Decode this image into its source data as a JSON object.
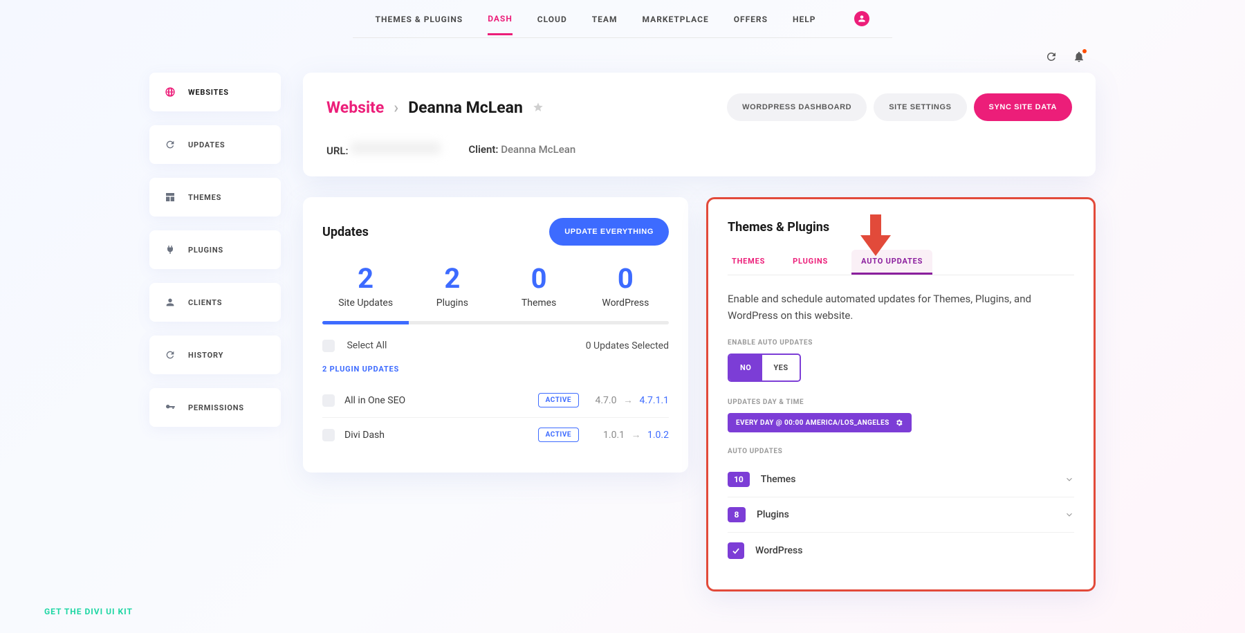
{
  "topNav": {
    "items": [
      "THEMES & PLUGINS",
      "DASH",
      "CLOUD",
      "TEAM",
      "MARKETPLACE",
      "OFFERS",
      "HELP"
    ],
    "activeIndex": 1
  },
  "sidebar": {
    "items": [
      {
        "label": "WEBSITES",
        "icon": "globe"
      },
      {
        "label": "UPDATES",
        "icon": "refresh"
      },
      {
        "label": "THEMES",
        "icon": "layout"
      },
      {
        "label": "PLUGINS",
        "icon": "plug"
      },
      {
        "label": "CLIENTS",
        "icon": "user"
      },
      {
        "label": "HISTORY",
        "icon": "refresh"
      },
      {
        "label": "PERMISSIONS",
        "icon": "key"
      }
    ],
    "activeIndex": 0
  },
  "header": {
    "breadcrumbRoot": "Website",
    "breadcrumbLeaf": "Deanna McLean",
    "urlLabel": "URL:",
    "clientLabel": "Client:",
    "clientName": "Deanna McLean",
    "actions": {
      "wpDash": "WORDPRESS DASHBOARD",
      "siteSettings": "SITE SETTINGS",
      "syncSite": "SYNC SITE DATA"
    }
  },
  "updates": {
    "title": "Updates",
    "updateAllBtn": "UPDATE EVERYTHING",
    "stats": [
      {
        "num": "2",
        "label": "Site Updates"
      },
      {
        "num": "2",
        "label": "Plugins"
      },
      {
        "num": "0",
        "label": "Themes"
      },
      {
        "num": "0",
        "label": "WordPress"
      }
    ],
    "selectAll": "Select All",
    "selectedText": "0 Updates Selected",
    "pluginSectionLabel": "2 PLUGIN UPDATES",
    "plugins": [
      {
        "name": "All in One SEO",
        "status": "ACTIVE",
        "from": "4.7.0",
        "to": "4.7.1.1"
      },
      {
        "name": "Divi Dash",
        "status": "ACTIVE",
        "from": "1.0.1",
        "to": "1.0.2"
      }
    ]
  },
  "autoUpdates": {
    "title": "Themes & Plugins",
    "tabs": [
      "THEMES",
      "PLUGINS",
      "AUTO UPDATES"
    ],
    "activeTab": 2,
    "description": "Enable and schedule automated updates for Themes, Plugins, and WordPress on this website.",
    "enableLabel": "ENABLE AUTO UPDATES",
    "toggleNo": "NO",
    "toggleYes": "YES",
    "scheduleLabel": "UPDATES DAY & TIME",
    "scheduleText": "EVERY DAY  @ 00:00  AMERICA/LOS_ANGELES",
    "autoLabel": "AUTO UPDATES",
    "rows": [
      {
        "count": "10",
        "label": "Themes",
        "type": "count"
      },
      {
        "count": "8",
        "label": "Plugins",
        "type": "count"
      },
      {
        "label": "WordPress",
        "type": "check"
      }
    ]
  },
  "footer": {
    "uiKit": "GET THE DIVI UI KIT"
  }
}
